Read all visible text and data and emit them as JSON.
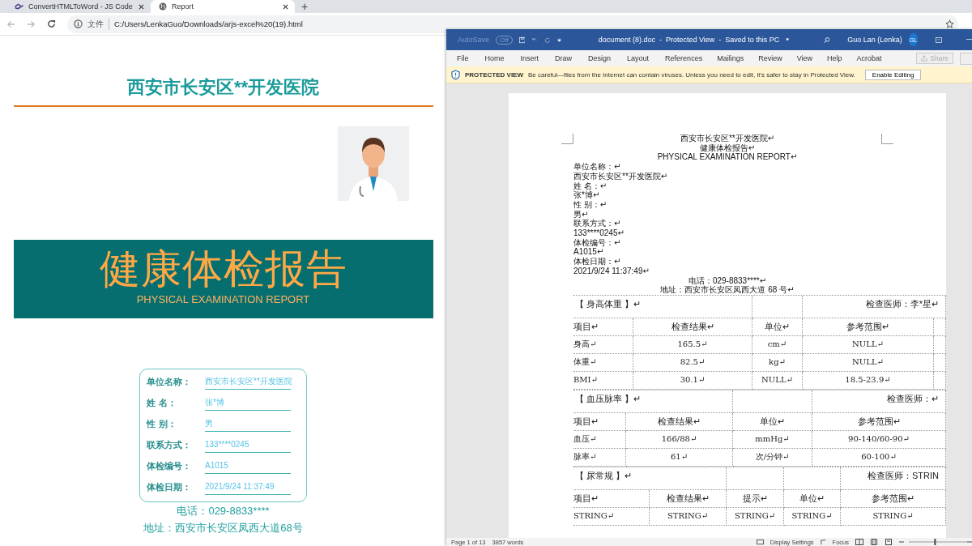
{
  "browser": {
    "tabs": [
      {
        "title": "ConvertHTMLToWord - JS Code",
        "selected": false
      },
      {
        "title": "Report",
        "selected": true
      }
    ],
    "new_tab": "+",
    "scheme_label": "文件",
    "url": "C:/Users/LenkaGuo/Downloads/arjs-excel%20(19).html"
  },
  "report": {
    "hospital": "西安市长安区**开发医院",
    "banner_title": "健康体检报告",
    "banner_subtitle": "PHYSICAL EXAMINATION REPORT",
    "fields": [
      {
        "label": "单位名称：",
        "value": "西安市长安区**开发医院"
      },
      {
        "label": "姓 名：",
        "value": "张*博"
      },
      {
        "label": "性 别：",
        "value": "男"
      },
      {
        "label": "联系方式：",
        "value": "133****0245"
      },
      {
        "label": "体检编号：",
        "value": "A1015"
      },
      {
        "label": "体检日期：",
        "value": "2021/9/24 11:37:49"
      }
    ],
    "phone": "电话：029-8833****",
    "address": "地址：西安市长安区凤西大道68号"
  },
  "word": {
    "autosave": "AutoSave",
    "autosave_toggle": {
      "label": "Off",
      "on": false
    },
    "title": "document (8).doc  -  Protected View  -  Saved to this PC",
    "user": "Guo Lan (Lenka)",
    "initials": "GL",
    "ribbon_tabs": [
      "File",
      "Home",
      "Insert",
      "Draw",
      "Design",
      "Layout",
      "References",
      "Mailings",
      "Review",
      "View",
      "Help",
      "Acrobat"
    ],
    "share": {
      "label": "Share",
      "disabled": true
    },
    "protected": {
      "label": "PROTECTED VIEW",
      "message": "Be careful—files from the Internet can contain viruses. Unless you need to edit, it's safer to stay in Protected View.",
      "button": "Enable Editing"
    },
    "document": {
      "heading_lines": [
        "西安市长安区**开发医院↵",
        "健康体检报告↵",
        "PHYSICAL EXAMINATION REPORT↵"
      ],
      "info_lines": [
        "单位名称：↵",
        "西安市长安区**开发医院↵",
        "姓 名：↵",
        "张*博↵",
        "性 别：↵",
        "男↵",
        "联系方式：↵",
        "133****0245↵",
        "体检编号：↵",
        "A1015↵",
        "体检日期：↵",
        "2021/9/24 11:37:49↵"
      ],
      "contact_lines": [
        "电话：029-8833****↵",
        "地址：西安市长安区凤西大道 68 号↵"
      ],
      "tables": [
        {
          "title": "【 身高体重 】↵",
          "doctor": "检查医师：李*星↵",
          "columns": [
            "项目↵",
            "检查结果↵",
            "单位↵",
            "参考范围↵"
          ],
          "rows": [
            [
              "身高↵",
              "165.5↵",
              "cm↵",
              "NULL↵"
            ],
            [
              "体重↵",
              "82.5↵",
              "kg↵",
              "NULL↵"
            ],
            [
              "BMI↵",
              "30.1↵",
              "NULL↵",
              "18.5-23.9↵"
            ]
          ]
        },
        {
          "title": "【 血压脉率 】↵",
          "doctor": "检查医师：↵",
          "columns": [
            "项目↵",
            "检查结果↵",
            "单位↵",
            "参考范围↵"
          ],
          "rows": [
            [
              "血压↵",
              "166/88↵",
              "mmHg↵",
              "90-140/60-90↵"
            ],
            [
              "脉率↵",
              "61↵",
              "次/分钟↵",
              "60-100↵"
            ]
          ]
        },
        {
          "title": "【 尿常规 】↵",
          "doctor": "检查医师：STRIN",
          "columns": [
            "项目↵",
            "检查结果↵",
            "提示↵",
            "单位↵",
            "参考范围↵"
          ],
          "rows": [
            [
              "STRING↵",
              "STRING↵",
              "STRING↵",
              "STRING↵",
              "STRING↵"
            ]
          ]
        }
      ]
    },
    "status_bar": {
      "page": "Page 1 of 13",
      "words": "3857 words",
      "display_settings": "Display Settings",
      "focus": "Focus",
      "zoom": {
        "level": 0.45
      }
    }
  }
}
